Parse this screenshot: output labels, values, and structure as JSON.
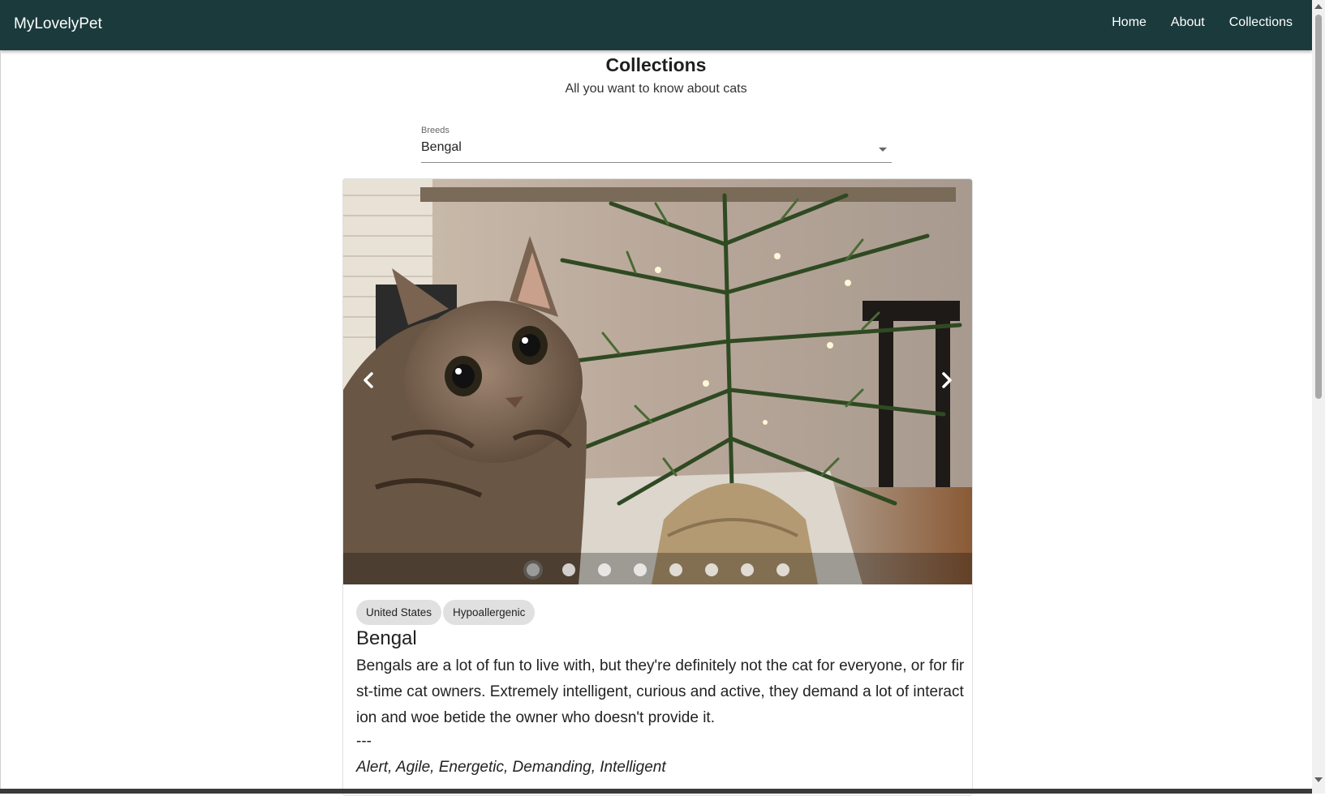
{
  "appbar": {
    "brand": "MyLovelyPet",
    "nav": [
      "Home",
      "About",
      "Collections"
    ]
  },
  "page": {
    "title": "Collections",
    "subtitle": "All you want to know about cats"
  },
  "select": {
    "label": "Breeds",
    "value": "Bengal"
  },
  "carousel": {
    "slide_count": 8,
    "active_index": 0
  },
  "breed": {
    "tags": [
      "United States",
      "Hypoallergenic"
    ],
    "name": "Bengal",
    "description": "Bengals are a lot of fun to live with, but they're definitely not the cat for everyone, or for first-time cat owners. Extremely intelligent, curious and active, they demand a lot of interaction and woe betide the owner who doesn't provide it.",
    "separator": "---",
    "temperament": "Alert, Agile, Energetic, Demanding, Intelligent"
  },
  "colors": {
    "appbar": "#1b3a3c",
    "chip": "#e0e0e0"
  }
}
